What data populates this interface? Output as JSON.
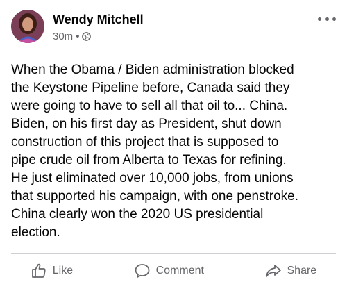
{
  "post": {
    "author": "Wendy Mitchell",
    "time": "30m",
    "separator": "•",
    "privacy_icon": "globe-icon",
    "more_icon": "more-options-icon",
    "text": "When the Obama / Biden administration blocked\nthe Keystone Pipeline before, Canada said they\nwere going to have to sell all that oil to... China.\nBiden, on his first day as President, shut down\nconstruction of this project that is supposed to\npipe crude oil from Alberta to Texas for refining.\nHe just eliminated over 10,000 jobs, from unions\nthat supported his campaign, with one penstroke.\nChina clearly won the 2020 US presidential\nelection."
  },
  "actions": {
    "like": "Like",
    "comment": "Comment",
    "share": "Share"
  },
  "colors": {
    "text": "#050505",
    "secondary": "#65676b",
    "divider": "#ced0d4"
  }
}
